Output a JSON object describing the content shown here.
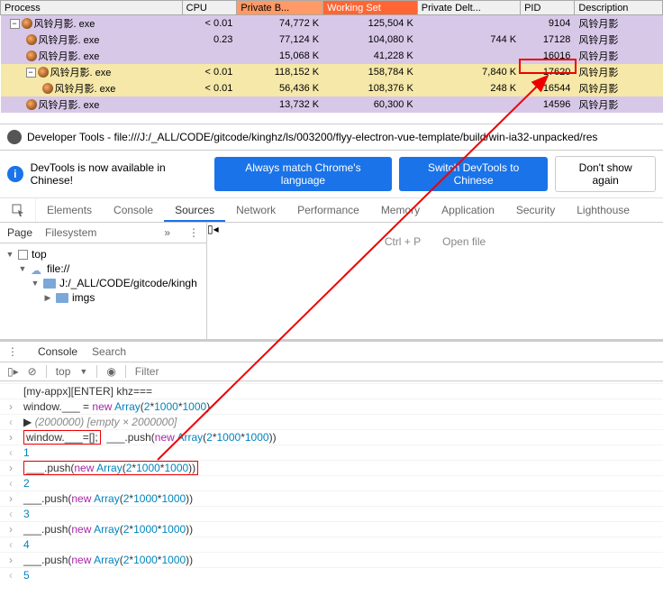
{
  "proc": {
    "headers": [
      "Process",
      "CPU",
      "Private B...",
      "Working Set",
      "Private Delt...",
      "PID",
      "Description"
    ],
    "rows": [
      {
        "indent": 0,
        "tree": "-",
        "name": "风铃月影. exe",
        "cpu": "< 0.01",
        "pb": "74,772 K",
        "ws": "125,504 K",
        "pd": "",
        "pid": "9104",
        "desc": "风铃月影",
        "cls": "row-purple"
      },
      {
        "indent": 1,
        "tree": "",
        "name": "风铃月影. exe",
        "cpu": "0.23",
        "pb": "77,124 K",
        "ws": "104,080 K",
        "pd": "744 K",
        "pid": "17128",
        "desc": "风铃月影",
        "cls": "row-purple"
      },
      {
        "indent": 1,
        "tree": "",
        "name": "风铃月影. exe",
        "cpu": "",
        "pb": "15,068 K",
        "ws": "41,228 K",
        "pd": "",
        "pid": "16016",
        "desc": "风铃月影",
        "cls": "row-purple"
      },
      {
        "indent": 1,
        "tree": "-",
        "name": "风铃月影. exe",
        "cpu": "< 0.01",
        "pb": "118,152 K",
        "ws": "158,784 K",
        "pd": "7,840 K",
        "pid": "17620",
        "desc": "风铃月影",
        "cls": "row-yellow"
      },
      {
        "indent": 2,
        "tree": "",
        "name": "风铃月影. exe",
        "cpu": "< 0.01",
        "pb": "56,436 K",
        "ws": "108,376 K",
        "pd": "248 K",
        "pid": "16544",
        "desc": "风铃月影",
        "cls": "row-yellow"
      },
      {
        "indent": 1,
        "tree": "",
        "name": "风铃月影. exe",
        "cpu": "",
        "pb": "13,732 K",
        "ws": "60,300 K",
        "pd": "",
        "pid": "14596",
        "desc": "风铃月影",
        "cls": "row-purple"
      }
    ]
  },
  "devtools": {
    "title": "Developer Tools - file:///J:/_ALL/CODE/gitcode/kinghz/ls/003200/flyy-electron-vue-template/build/win-ia32-unpacked/res",
    "info": {
      "text": "DevTools is now available in Chinese!",
      "btn1": "Always match Chrome's language",
      "btn2": "Switch DevTools to Chinese",
      "btn3": "Don't show again"
    },
    "tabs": [
      "Elements",
      "Console",
      "Sources",
      "Network",
      "Performance",
      "Memory",
      "Application",
      "Security",
      "Lighthouse"
    ],
    "activeTab": "Sources",
    "nav": {
      "page": "Page",
      "filesystem": "Filesystem",
      "top": "top",
      "file": "file://",
      "folder1": "J:/_ALL/CODE/gitcode/kingh",
      "folder2": "imgs"
    },
    "empty": {
      "hint": "Ctrl + P",
      "action": "Open file"
    },
    "drawer": {
      "console": "Console",
      "search": "Search"
    },
    "consoleTools": {
      "scope": "top",
      "filterPh": "Filter"
    },
    "lines": [
      {
        "t": "log",
        "html": "[my-appx][ENTER] khz==="
      },
      {
        "t": "in",
        "html": "window.___ = <span class='tk-kw'>new</span> <span class='tk-cls'>Array</span>(<span class='tk-num'>2</span>*<span class='tk-num'>1000</span>*<span class='tk-num'>1000</span>)"
      },
      {
        "t": "out",
        "html": "▶ <span class='tk-gray'>(2000000) [empty × 2000000]</span>"
      },
      {
        "t": "in",
        "html": "<span class='red-box'>window.___=[];</span>&nbsp; ___.push(<span class='tk-kw'>new</span> <span class='tk-cls'>Array</span>(<span class='tk-num'>2</span>*<span class='tk-num'>1000</span>*<span class='tk-num'>1000</span>))"
      },
      {
        "t": "out",
        "html": "<span class='tk-num'>1</span>"
      },
      {
        "t": "in",
        "html": "<span class='red-box'>___.push(<span class='tk-kw'>new</span> <span class='tk-cls'>Array</span>(<span class='tk-num'>2</span>*<span class='tk-num'>1000</span>*<span class='tk-num'>1000</span>))</span>"
      },
      {
        "t": "out",
        "html": "<span class='tk-num'>2</span>"
      },
      {
        "t": "in",
        "html": "___.push(<span class='tk-kw'>new</span> <span class='tk-cls'>Array</span>(<span class='tk-num'>2</span>*<span class='tk-num'>1000</span>*<span class='tk-num'>1000</span>))"
      },
      {
        "t": "out",
        "html": "<span class='tk-num'>3</span>"
      },
      {
        "t": "in",
        "html": "___.push(<span class='tk-kw'>new</span> <span class='tk-cls'>Array</span>(<span class='tk-num'>2</span>*<span class='tk-num'>1000</span>*<span class='tk-num'>1000</span>))"
      },
      {
        "t": "out",
        "html": "<span class='tk-num'>4</span>"
      },
      {
        "t": "in",
        "html": "___.push(<span class='tk-kw'>new</span> <span class='tk-cls'>Array</span>(<span class='tk-num'>2</span>*<span class='tk-num'>1000</span>*<span class='tk-num'>1000</span>))"
      },
      {
        "t": "out",
        "html": "<span class='tk-num'>5</span>"
      }
    ]
  }
}
